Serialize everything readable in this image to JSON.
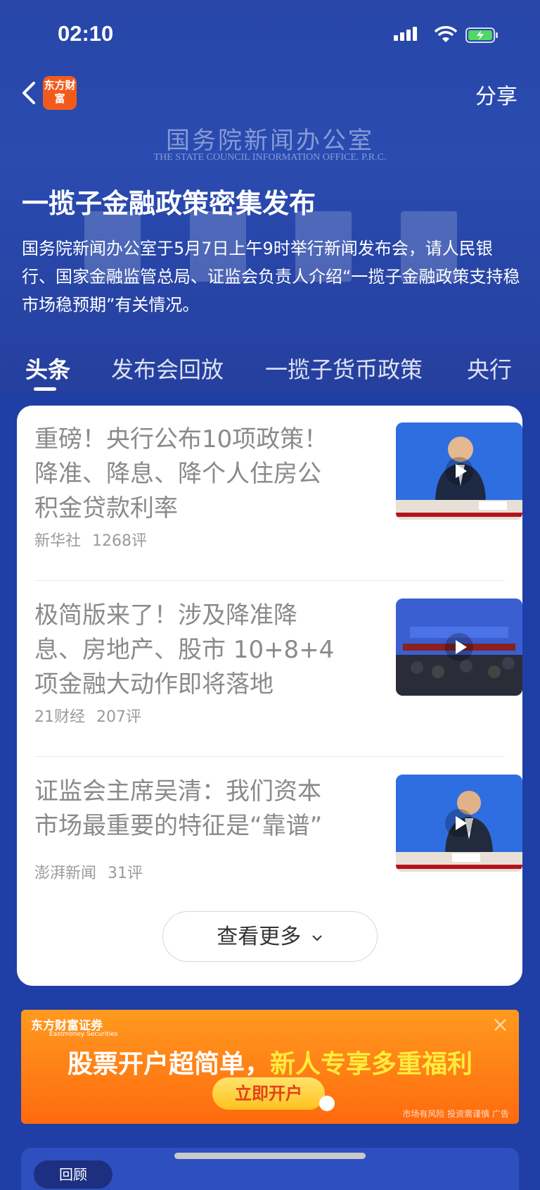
{
  "status_bar": {
    "time": "02:10"
  },
  "nav": {
    "logo_text": "东方财富",
    "share_label": "分享"
  },
  "hero": {
    "office_cn": "国务院新闻办公室",
    "office_en": "THE STATE COUNCIL INFORMATION OFFICE. P.R.C.",
    "title": "一揽子金融政策密集发布",
    "description": "国务院新闻办公室于5月7日上午9时举行新闻发布会，请人民银行、国家金融监管总局、证监会负责人介绍“一揽子金融政策支持稳市场稳预期”有关情况。"
  },
  "tabs": [
    {
      "label": "头条",
      "active": true
    },
    {
      "label": "发布会回放",
      "active": false
    },
    {
      "label": "一揽子货币政策",
      "active": false
    },
    {
      "label": "央行",
      "active": false
    }
  ],
  "news": [
    {
      "title": "重磅！央行公布10项政策！降准、降息、降个人住房公积金贷款利率",
      "source": "新华社",
      "comments": "1268评"
    },
    {
      "title": "极简版来了！涉及降准降息、房地产、股市 10+8+4项金融大动作即将落地",
      "source": "21财经",
      "comments": "207评"
    },
    {
      "title": "证监会主席吴清：我们资本市场最重要的特征是“靠谱”",
      "source": "澎湃新闻",
      "comments": "31评"
    }
  ],
  "more_label": "查看更多",
  "ad": {
    "brand": "东方财富证券",
    "brand_en": "Eastmoney Securities",
    "slogan_part1": "股票开户超简单，",
    "slogan_part2": "新人专享多重福利",
    "cta": "立即开户",
    "risk_note": "市场有风险 投资需谨慎 广告"
  },
  "bottom": {
    "tag": "回顾"
  },
  "colors": {
    "brand_orange": "#f25a1c",
    "hero_blue": "#2746a8",
    "card_bg": "#ffffff"
  }
}
